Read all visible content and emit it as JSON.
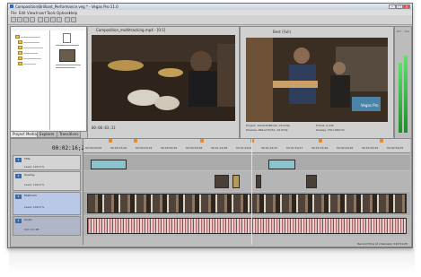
{
  "window": {
    "title": "Composition\\Brilliant_Performance.veg * - Vegas Pro 11.0",
    "buttons": [
      "–",
      "□",
      "×"
    ]
  },
  "menu": [
    "File",
    "Edit",
    "View",
    "Insert",
    "Tools",
    "Options",
    "Help"
  ],
  "trimmer": {
    "title": "Composition_multitracking.mp4 - [0:1]",
    "timecode": "00:00:03;33"
  },
  "preview": {
    "label": "Best (Full)",
    "project_info": "Project: 1920x1080x32, 29.970p",
    "preview_info": "Preview: 480x270x32, 29.970p",
    "frame": "Frame: 2,245",
    "display": "Display: 331x186x32",
    "overlay": "Vegas Pro"
  },
  "meters": {
    "label": "Master",
    "values": [
      "-3.7",
      "-3.1"
    ],
    "levels": [
      0.72,
      0.8
    ]
  },
  "explorer": {
    "file_name": "Composition_multitracking.mp4",
    "file_name2": "Composition_multi..."
  },
  "tabs": [
    "Project Media",
    "Explorer",
    "Transitions"
  ],
  "timeline": {
    "timecode": "00:02:16;27",
    "ruler": [
      "00:00:00;00",
      "00:00:15;00",
      "00:00:29;29",
      "00:00:44;29",
      "00:00:59;28",
      "00:01:14;28",
      "00:01:29;28",
      "00:01:44;27",
      "00:01:59;27",
      "00:02:14;26",
      "00:02:29;26",
      "00:02:44;25",
      "00:02:59;25"
    ],
    "tracks": [
      {
        "num": "1",
        "name": "Title",
        "level": "Level: 100.0 %"
      },
      {
        "num": "2",
        "name": "Overlay",
        "level": "Level: 100.0 %"
      },
      {
        "num": "3",
        "name": "Multicam",
        "level": "Level: 100.0 %"
      },
      {
        "num": "4",
        "name": "Audio",
        "level": "Vol: 0.0 dB"
      }
    ],
    "status": "Record Time (2 channels): 122:51:25"
  },
  "colors": {
    "accent": "#3c6aa8",
    "clip_cyan": "#8bc4cf",
    "meter": "#3fbf4b",
    "marker": "#e58a2a"
  }
}
